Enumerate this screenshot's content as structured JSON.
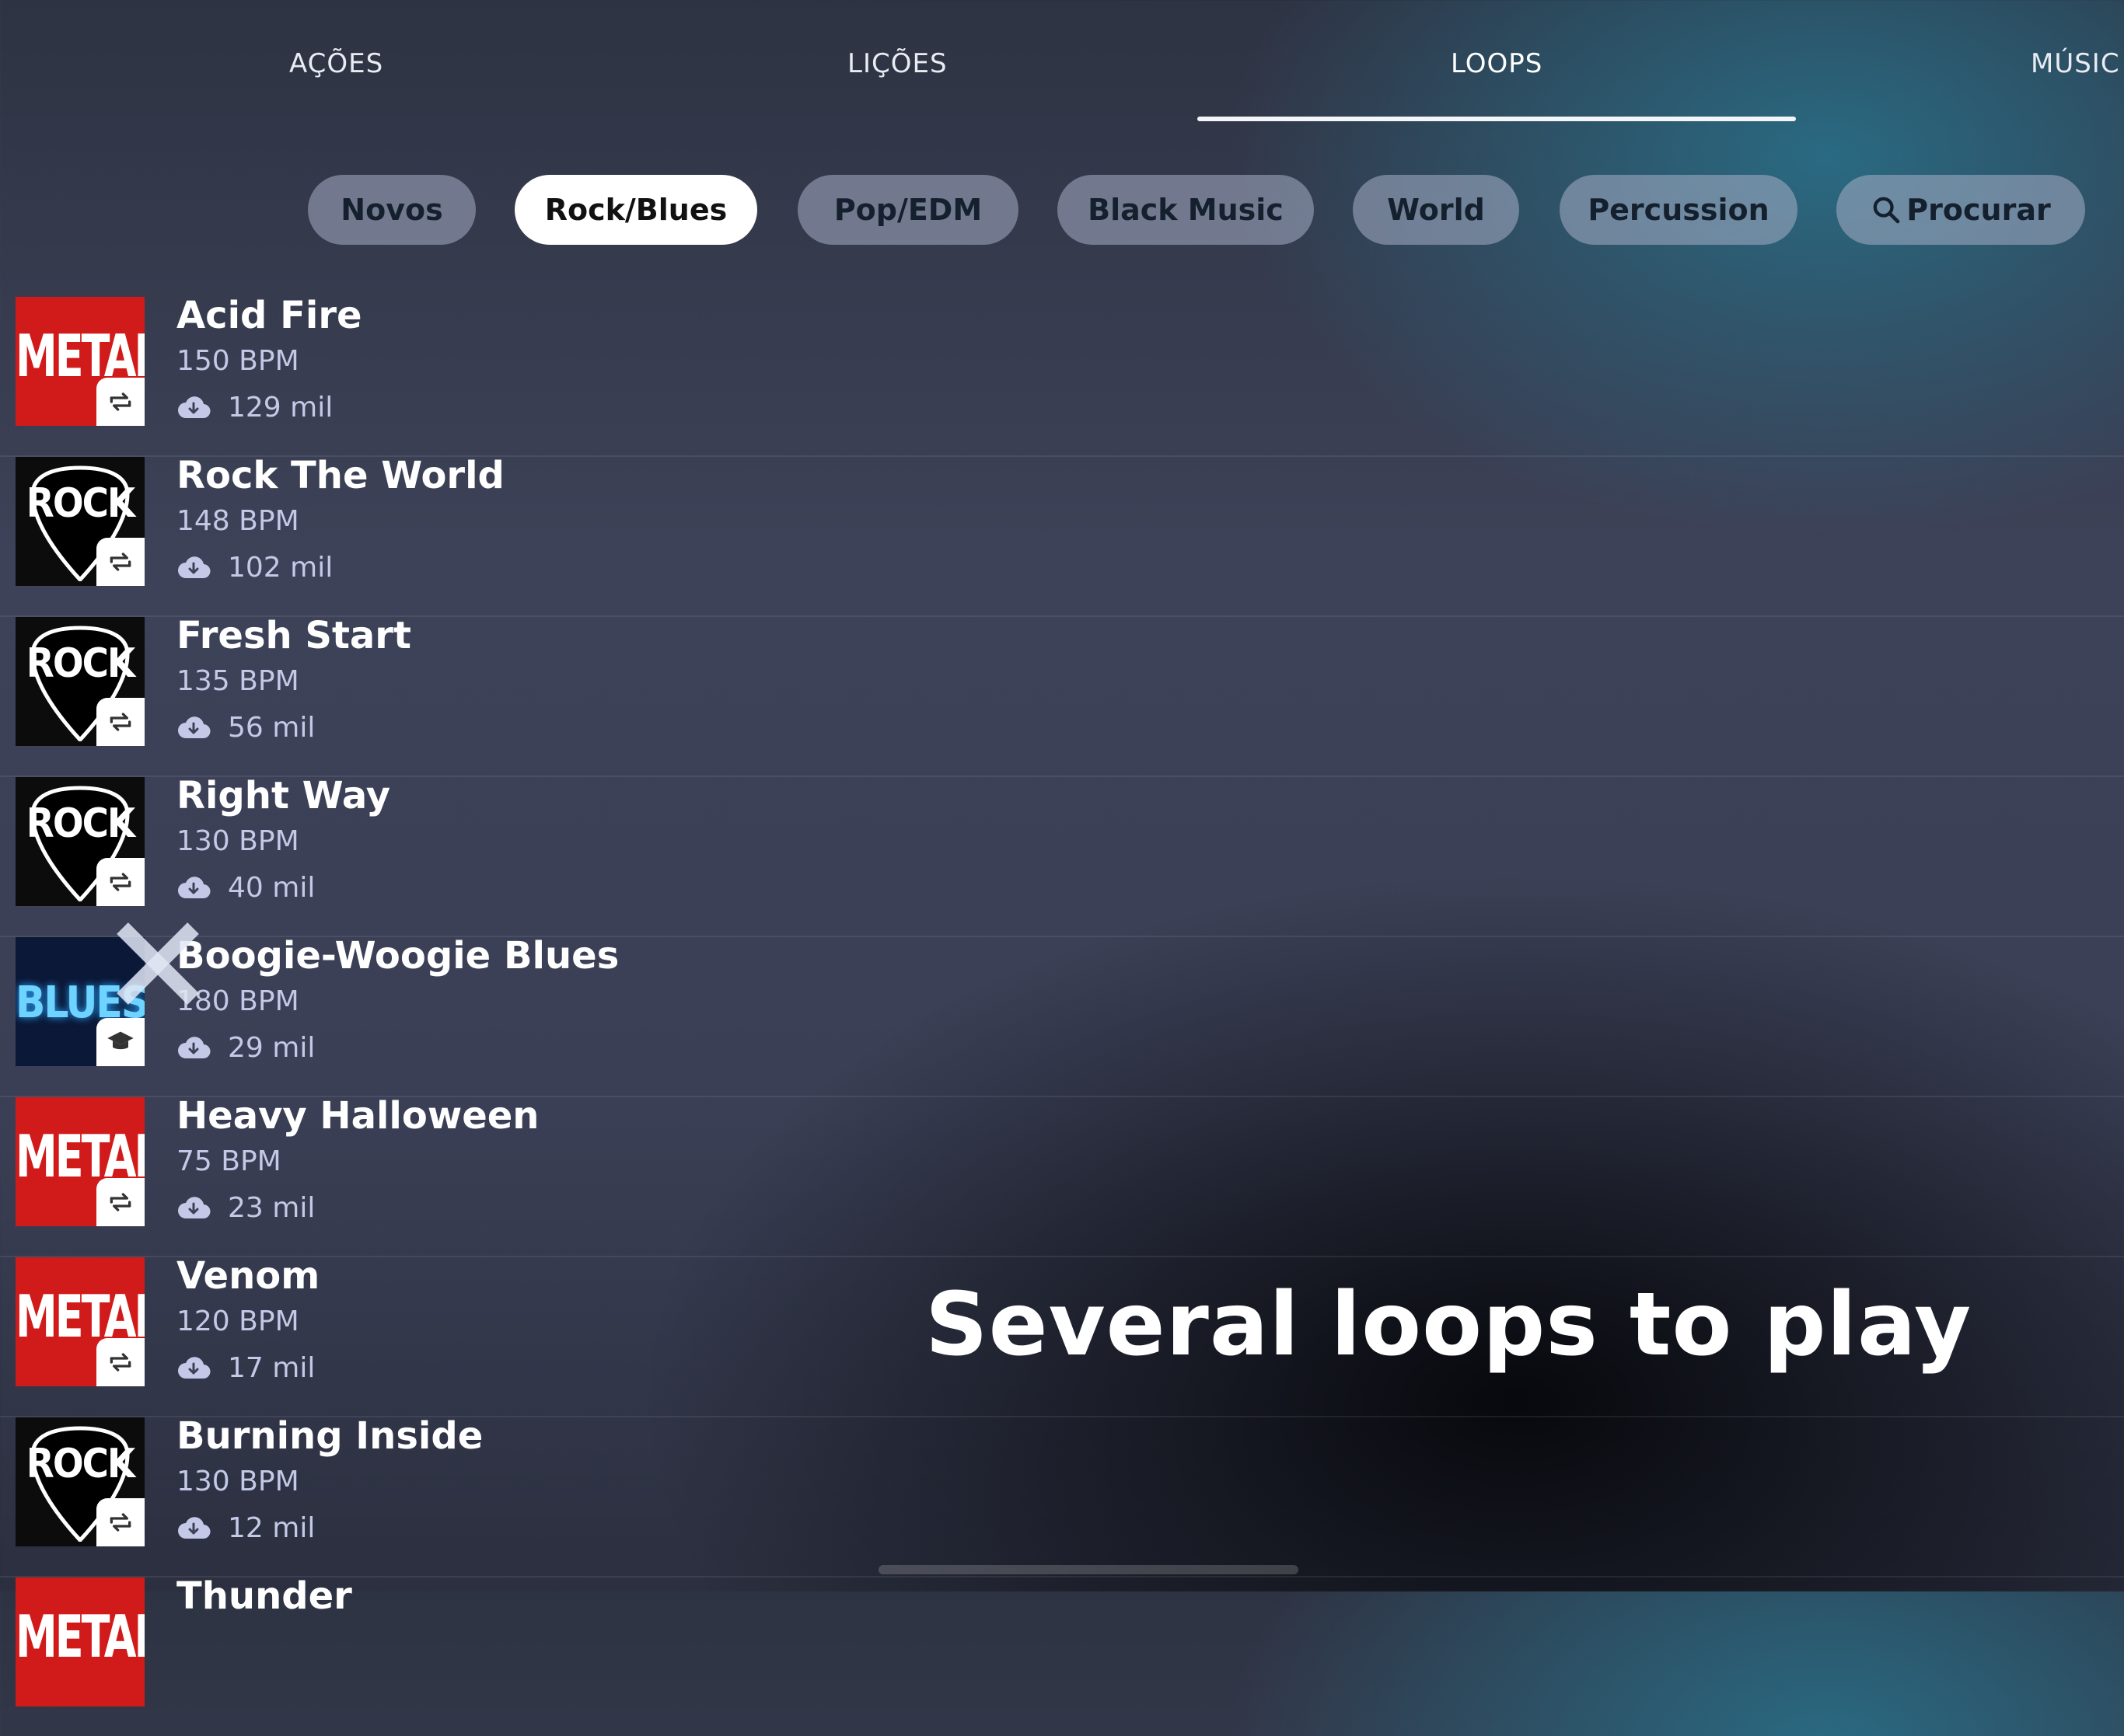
{
  "tabs": [
    {
      "label": "AÇÕES",
      "active": false
    },
    {
      "label": "LIÇÕES",
      "active": false
    },
    {
      "label": "LOOPS",
      "active": true
    },
    {
      "label": "MÚSIC",
      "active": false
    }
  ],
  "filters": [
    {
      "label": "Novos",
      "active": false
    },
    {
      "label": "Rock/Blues",
      "active": true
    },
    {
      "label": "Pop/EDM",
      "active": false
    },
    {
      "label": "Black Music",
      "active": false
    },
    {
      "label": "World",
      "active": false
    },
    {
      "label": "Percussion",
      "active": false
    },
    {
      "label": "Procurar",
      "icon": "search-icon",
      "active": false
    }
  ],
  "loops": [
    {
      "title": "Acid Fire",
      "bpm": "150 BPM",
      "downloads": "129 mil",
      "art": "METAL",
      "badge": "loop-icon"
    },
    {
      "title": "Rock The World",
      "bpm": "148 BPM",
      "downloads": "102 mil",
      "art": "ROCK",
      "badge": "loop-icon"
    },
    {
      "title": "Fresh Start",
      "bpm": "135 BPM",
      "downloads": "56 mil",
      "art": "ROCK",
      "badge": "loop-icon"
    },
    {
      "title": "Right Way",
      "bpm": "130 BPM",
      "downloads": "40 mil",
      "art": "ROCK",
      "badge": "loop-icon"
    },
    {
      "title": "Boogie-Woogie Blues",
      "bpm": "180 BPM",
      "downloads": "29 mil",
      "art": "BLUES",
      "badge": "graduation-cap-icon"
    },
    {
      "title": "Heavy Halloween",
      "bpm": "75 BPM",
      "downloads": "23 mil",
      "art": "METAL",
      "badge": "loop-icon"
    },
    {
      "title": "Venom",
      "bpm": "120 BPM",
      "downloads": "17 mil",
      "art": "METAL",
      "badge": "loop-icon"
    },
    {
      "title": "Burning Inside",
      "bpm": "130 BPM",
      "downloads": "12 mil",
      "art": "ROCK",
      "badge": "loop-icon"
    },
    {
      "title": "Thunder",
      "bpm": "",
      "downloads": "",
      "art": "METAL",
      "badge": "loop-icon"
    }
  ],
  "promo_text": "Several loops to play",
  "colors": {
    "accent_teal": "#28738c",
    "chip_inactive": "#a5afc6",
    "text_secondary": "#c3c9e6",
    "metal_red": "#d11b1b"
  }
}
